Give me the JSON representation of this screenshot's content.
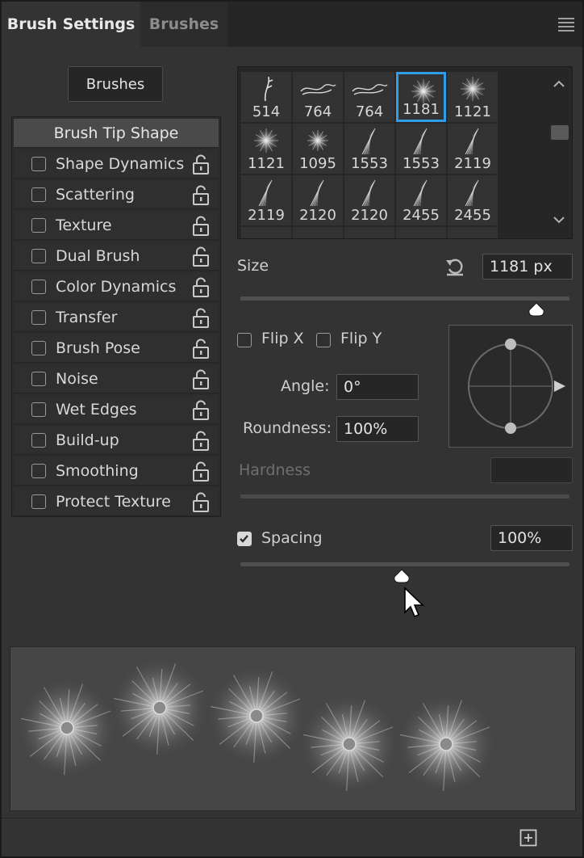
{
  "tabs": [
    {
      "label": "Brush Settings",
      "active": true
    },
    {
      "label": "Brushes",
      "active": false
    }
  ],
  "brushes_button": "Brushes",
  "options": [
    {
      "label": "Brush Tip Shape",
      "header": true
    },
    {
      "label": "Shape Dynamics",
      "checked": false
    },
    {
      "label": "Scattering",
      "checked": false
    },
    {
      "label": "Texture",
      "checked": false
    },
    {
      "label": "Dual Brush",
      "checked": false
    },
    {
      "label": "Color Dynamics",
      "checked": false
    },
    {
      "label": "Transfer",
      "checked": false
    },
    {
      "label": "Brush Pose",
      "checked": false
    },
    {
      "label": "Noise",
      "checked": false
    },
    {
      "label": "Wet Edges",
      "checked": false
    },
    {
      "label": "Build-up",
      "checked": false
    },
    {
      "label": "Smoothing",
      "checked": false
    },
    {
      "label": "Protect Texture",
      "checked": false
    }
  ],
  "brush_grid": {
    "rows": [
      [
        "514",
        "764",
        "764",
        "1181",
        "1121"
      ],
      [
        "1121",
        "1095",
        "1553",
        "1553",
        "2119"
      ],
      [
        "2119",
        "2120",
        "2120",
        "2455",
        "2455"
      ]
    ],
    "selected": "1181"
  },
  "size": {
    "label": "Size",
    "value": "1181 px",
    "slider_fraction": 0.9
  },
  "flip_x": {
    "label": "Flip X",
    "checked": false
  },
  "flip_y": {
    "label": "Flip Y",
    "checked": false
  },
  "angle": {
    "label": "Angle:",
    "value": "0°"
  },
  "roundness": {
    "label": "Roundness:",
    "value": "100%"
  },
  "hardness": {
    "label": "Hardness",
    "value": ""
  },
  "spacing": {
    "label": "Spacing",
    "value": "100%",
    "checked": true,
    "slider_fraction": 0.49
  },
  "colors": {
    "accent": "#2e9fe6",
    "panel": "#333333",
    "tabbar": "#262626"
  },
  "icons": {
    "menu": "hamburger-icon",
    "lock": "unlocked-padlock-icon",
    "reset": "reset-arrow-icon",
    "add": "add-square-icon",
    "cursor": "mouse-pointer-icon"
  }
}
